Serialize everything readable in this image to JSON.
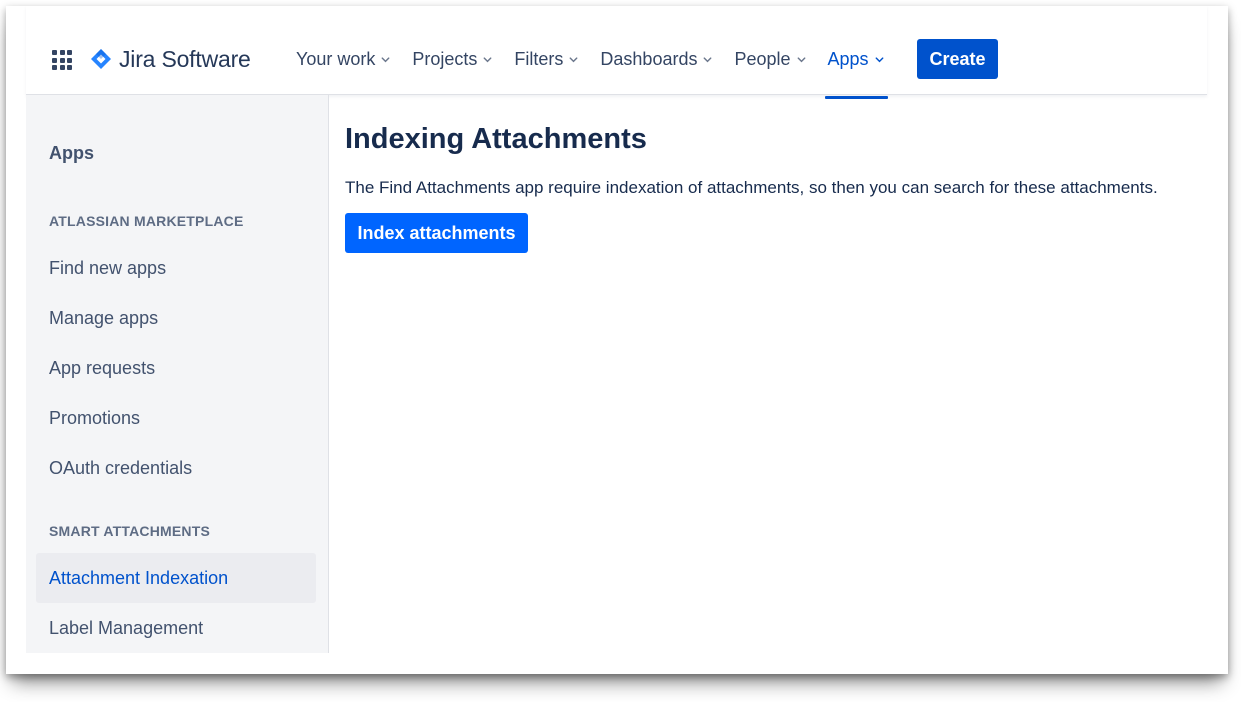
{
  "header": {
    "app_name": "Jira Software",
    "nav": [
      {
        "label": "Your work"
      },
      {
        "label": "Projects"
      },
      {
        "label": "Filters"
      },
      {
        "label": "Dashboards"
      },
      {
        "label": "People"
      },
      {
        "label": "Apps",
        "active": true
      }
    ],
    "create_label": "Create"
  },
  "sidebar": {
    "title": "Apps",
    "sections": [
      {
        "heading": "ATLASSIAN MARKETPLACE",
        "items": [
          {
            "label": "Find new apps"
          },
          {
            "label": "Manage apps"
          },
          {
            "label": "App requests"
          },
          {
            "label": "Promotions"
          },
          {
            "label": "OAuth credentials"
          }
        ]
      },
      {
        "heading": "SMART ATTACHMENTS",
        "items": [
          {
            "label": "Attachment Indexation",
            "selected": true
          },
          {
            "label": "Label Management"
          }
        ]
      }
    ]
  },
  "main": {
    "title": "Indexing Attachments",
    "description": "The Find Attachments app require indexation of attachments, so then you can search for these attachments.",
    "button_label": "Index attachments"
  },
  "colors": {
    "brand_blue": "#0052cc",
    "button_blue": "#0065ff",
    "text_dark": "#172b4d",
    "sidebar_bg": "#f4f5f7",
    "selected_bg": "#ebecf0"
  }
}
